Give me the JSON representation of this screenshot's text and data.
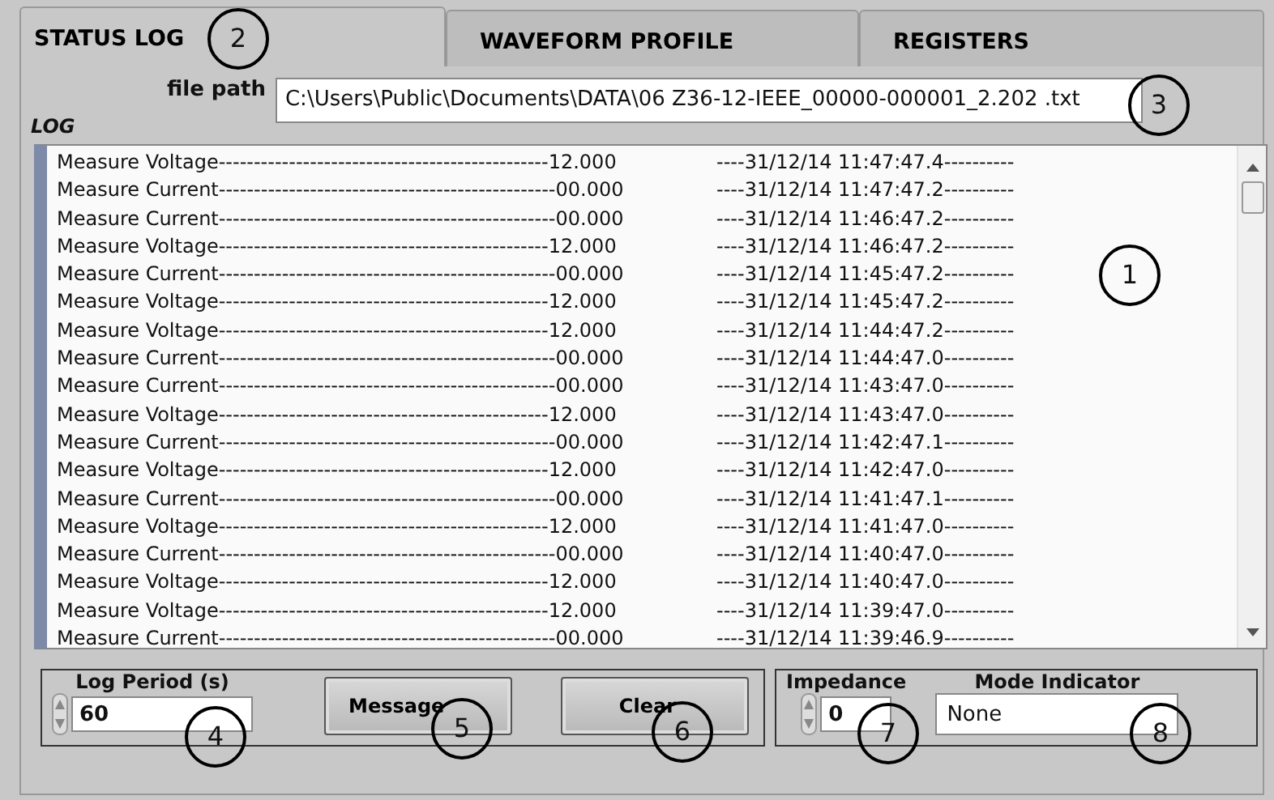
{
  "tabs": [
    {
      "label": "STATUS LOG",
      "selected": true,
      "callout": "2"
    },
    {
      "label": "WAVEFORM PROFILE",
      "selected": false
    },
    {
      "label": "REGISTERS",
      "selected": false
    }
  ],
  "file_path": {
    "label": "file path",
    "value": "C:\\Users\\Public\\Documents\\DATA\\06 Z36-12-IEEE_00000-000001_2.202 .txt",
    "callout": "3"
  },
  "log": {
    "label": "LOG",
    "callout": "1",
    "rows": [
      {
        "entry": "Measure Voltage-----------------------------------------------12.000",
        "timestamp": "----31/12/14 11:47:47.4----------"
      },
      {
        "entry": "Measure Current------------------------------------------------00.000",
        "timestamp": "----31/12/14 11:47:47.2----------"
      },
      {
        "entry": "Measure Current------------------------------------------------00.000",
        "timestamp": "----31/12/14 11:46:47.2----------"
      },
      {
        "entry": "Measure Voltage-----------------------------------------------12.000",
        "timestamp": "----31/12/14 11:46:47.2----------"
      },
      {
        "entry": "Measure Current------------------------------------------------00.000",
        "timestamp": "----31/12/14 11:45:47.2----------"
      },
      {
        "entry": "Measure Voltage-----------------------------------------------12.000",
        "timestamp": "----31/12/14 11:45:47.2----------"
      },
      {
        "entry": "Measure Voltage-----------------------------------------------12.000",
        "timestamp": "----31/12/14 11:44:47.2----------"
      },
      {
        "entry": "Measure Current------------------------------------------------00.000",
        "timestamp": "----31/12/14 11:44:47.0----------"
      },
      {
        "entry": "Measure Current------------------------------------------------00.000",
        "timestamp": "----31/12/14 11:43:47.0----------"
      },
      {
        "entry": "Measure Voltage-----------------------------------------------12.000",
        "timestamp": "----31/12/14 11:43:47.0----------"
      },
      {
        "entry": "Measure Current------------------------------------------------00.000",
        "timestamp": "----31/12/14 11:42:47.1----------"
      },
      {
        "entry": "Measure Voltage-----------------------------------------------12.000",
        "timestamp": "----31/12/14 11:42:47.0----------"
      },
      {
        "entry": "Measure Current------------------------------------------------00.000",
        "timestamp": "----31/12/14 11:41:47.1----------"
      },
      {
        "entry": "Measure Voltage-----------------------------------------------12.000",
        "timestamp": "----31/12/14 11:41:47.0----------"
      },
      {
        "entry": "Measure Current------------------------------------------------00.000",
        "timestamp": "----31/12/14 11:40:47.0----------"
      },
      {
        "entry": "Measure Voltage-----------------------------------------------12.000",
        "timestamp": "----31/12/14 11:40:47.0----------"
      },
      {
        "entry": "Measure Voltage-----------------------------------------------12.000",
        "timestamp": "----31/12/14 11:39:47.0----------"
      },
      {
        "entry": "Measure Current------------------------------------------------00.000",
        "timestamp": "----31/12/14 11:39:46.9----------"
      }
    ]
  },
  "log_period": {
    "label": "Log Period (s)",
    "value": "60",
    "callout": "4"
  },
  "buttons": [
    {
      "label": "Message",
      "callout": "5"
    },
    {
      "label": "Clear",
      "callout": "6"
    }
  ],
  "impedance": {
    "label": "Impedance",
    "value": "0",
    "callout": "7"
  },
  "mode_indicator": {
    "label": "Mode Indicator",
    "value": "None",
    "callout": "8"
  }
}
